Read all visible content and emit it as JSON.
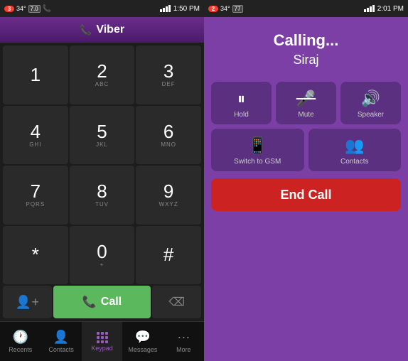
{
  "left": {
    "statusBar": {
      "badge": "3",
      "temp": "34°",
      "shield_badge": "7.0",
      "signal": "4",
      "time": "1:50 PM"
    },
    "header": {
      "title": "Viber"
    },
    "keys": [
      {
        "main": "1",
        "sub": ""
      },
      {
        "main": "2",
        "sub": "ABC"
      },
      {
        "main": "3",
        "sub": "DEF"
      },
      {
        "main": "4",
        "sub": "GHI"
      },
      {
        "main": "5",
        "sub": "JKL"
      },
      {
        "main": "6",
        "sub": "MNO"
      },
      {
        "main": "7",
        "sub": "PQRS"
      },
      {
        "main": "8",
        "sub": "TUV"
      },
      {
        "main": "9",
        "sub": "WXYZ"
      },
      {
        "main": "*",
        "sub": ""
      },
      {
        "main": "0",
        "sub": "+"
      },
      {
        "main": "#",
        "sub": ""
      }
    ],
    "callBtn": "Call",
    "nav": [
      {
        "label": "Recents",
        "icon": "🕐",
        "active": false
      },
      {
        "label": "Contacts",
        "icon": "👤",
        "active": false
      },
      {
        "label": "Keypad",
        "icon": "grid",
        "active": true
      },
      {
        "label": "Messages",
        "icon": "💬",
        "active": false
      },
      {
        "label": "More",
        "icon": "···",
        "active": false
      }
    ]
  },
  "right": {
    "statusBar": {
      "badge": "2",
      "temp": "34°",
      "shield_badge": "77",
      "signal": "4",
      "time": "2:01 PM"
    },
    "callingLabel": "Calling...",
    "calleeName": "Siraj",
    "controls": [
      [
        {
          "label": "Hold",
          "icon": "⏸"
        },
        {
          "label": "Mute",
          "icon": "🎤"
        },
        {
          "label": "Speaker",
          "icon": "🔊"
        }
      ],
      [
        {
          "label": "Switch to GSM",
          "icon": "📱"
        },
        {
          "label": "Contacts",
          "icon": "👥"
        }
      ]
    ],
    "endCallLabel": "End Call"
  }
}
